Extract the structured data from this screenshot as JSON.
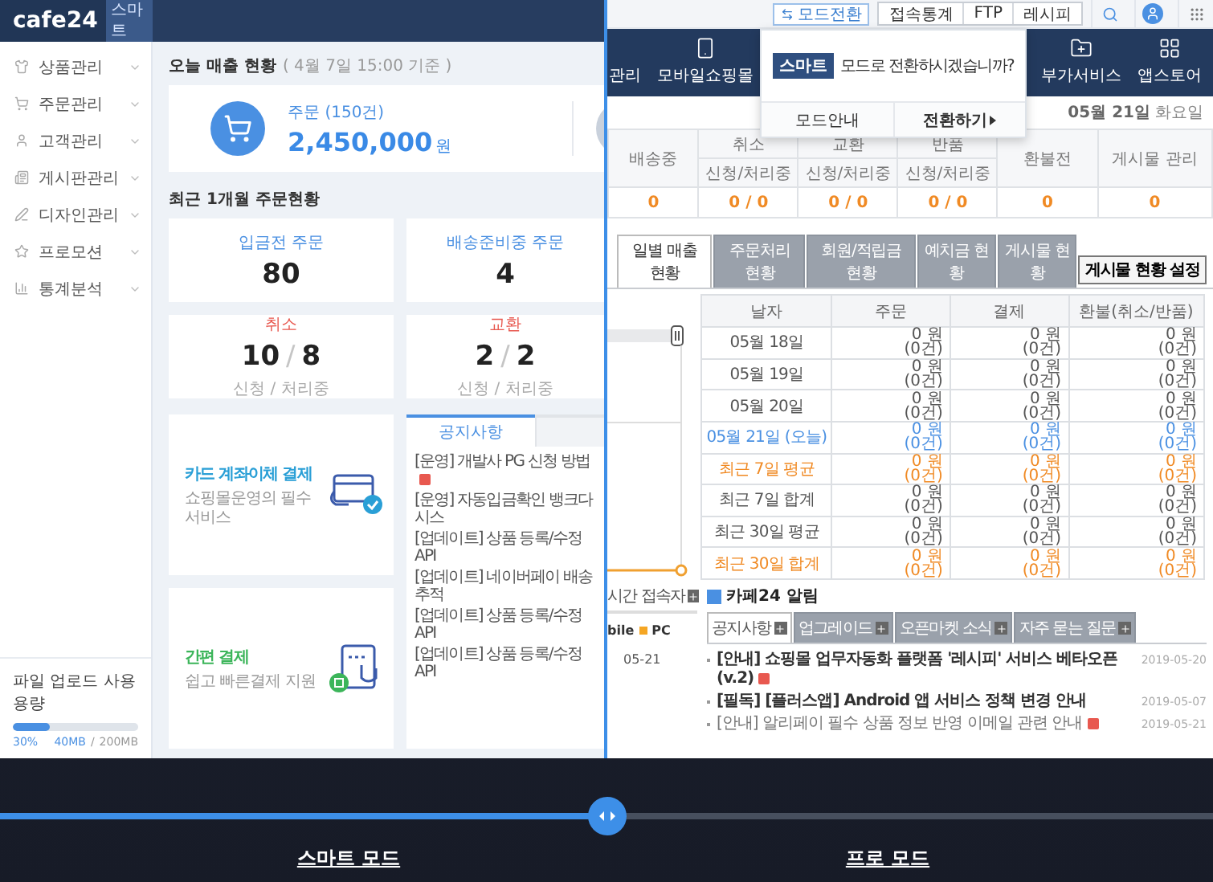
{
  "smart": {
    "logo": "cafe24",
    "badge": "스마트",
    "menu": [
      {
        "label": "상품관리",
        "kind": "product"
      },
      {
        "label": "주문관리",
        "kind": "order"
      },
      {
        "label": "고객관리",
        "kind": "customer"
      },
      {
        "label": "게시판관리",
        "kind": "board"
      },
      {
        "label": "디자인관리",
        "kind": "design"
      },
      {
        "label": "프로모션",
        "kind": "promotion"
      },
      {
        "label": "통계분석",
        "kind": "stats"
      }
    ],
    "usage": {
      "title": "파일 업로드 사용 용량",
      "level": 0.3,
      "percent": "30%",
      "used": "40MB",
      "sep": "/",
      "total": "200MB"
    },
    "sales": {
      "title": "오늘 매출 현황",
      "note": "( 4월 7일 15:00 기준 )",
      "label": "주문",
      "count": "(150건)",
      "amount": "2,450,000",
      "unit": "원"
    },
    "orders": {
      "title": "최근 1개월 주문현황",
      "cards": [
        {
          "label": "입금전 주문",
          "kind": "single",
          "value": "80"
        },
        {
          "label": "배송준비중 주문",
          "kind": "single",
          "value": "4"
        },
        {
          "label": "취소",
          "kind": "pair",
          "value": "10",
          "sep": "/",
          "value2": "8",
          "sub": "신청 / 처리중"
        },
        {
          "label": "교환",
          "kind": "pair",
          "value": "2",
          "sep": "/",
          "value2": "2",
          "sub": "신청 / 처리중"
        }
      ]
    },
    "services": [
      {
        "title": "카드 계좌이체 결제",
        "desc": "쇼핑몰운영의 필수 서비스",
        "kind": "card"
      },
      {
        "title": "간편 결제",
        "desc": "쉽고 빠른결제 지원",
        "kind": "simple"
      }
    ],
    "notice": {
      "tabs": [
        {
          "label": "공지사항",
          "selected": true
        }
      ],
      "items": [
        {
          "text": "[운영] 개발사 PG 신청 방법",
          "new": true
        },
        {
          "text": "[운영] 자동입금확인 뱅크다 시스",
          "new": false
        },
        {
          "text": "[업데이트] 상품 등록/수정 API",
          "new": false
        },
        {
          "text": "[업데이트] 네이버페이 배송추적",
          "new": false
        },
        {
          "text": "[업데이트] 상품 등록/수정 API",
          "new": false
        },
        {
          "text": "[업데이트] 상품 등록/수정 API",
          "new": false
        }
      ]
    }
  },
  "pro": {
    "mode_button": "모드전환",
    "top_buttons": [
      "접속통계",
      "FTP",
      "레시피"
    ],
    "nav_left": [
      {
        "label": "관리",
        "kind": "cut"
      },
      {
        "label": "모바일쇼핑몰",
        "kind": "mobile"
      }
    ],
    "nav_right": [
      {
        "label": "부가서비스",
        "kind": "addon"
      },
      {
        "label": "앱스토어",
        "kind": "apps"
      }
    ],
    "popup": {
      "badge": "스마트",
      "message": "모드로 전환하시겠습니까?",
      "buttons": [
        {
          "label": "모드안내",
          "kind": "plain"
        },
        {
          "label": "전환하기",
          "kind": "go"
        }
      ]
    },
    "date": "05월 21일",
    "weekday": "화요일",
    "summary": [
      {
        "head": "배송중",
        "value": "0"
      },
      {
        "head": "취소",
        "sub": "신청/처리중",
        "value": "0 / 0"
      },
      {
        "head": "교환",
        "sub": "신청/처리중",
        "value": "0 / 0"
      },
      {
        "head": "반품",
        "sub": "신청/처리중",
        "value": "0 / 0"
      },
      {
        "head": "환불전",
        "value": "0"
      },
      {
        "head": "게시물 관리",
        "value": "0"
      }
    ],
    "tabs": [
      {
        "label": "일별 매출 현황",
        "selected": true
      },
      {
        "label": "주문처리 현황",
        "selected": false
      },
      {
        "label": "회원/적립금 현황",
        "selected": false
      },
      {
        "label": "예치금 현황",
        "selected": false
      },
      {
        "label": "게시물 현황",
        "selected": false
      }
    ],
    "settings_button": "게시물 현황 설정",
    "chart_label": "05-21",
    "table": {
      "columns": [
        "날자",
        "주문",
        "결제",
        "환불(취소/반품)"
      ],
      "rows": [
        {
          "kind": "normal",
          "cells": [
            [
              "05월 18일"
            ],
            [
              "0 원",
              "(0건)"
            ],
            [
              "0 원",
              "(0건)"
            ],
            [
              "0 원",
              "(0건)"
            ]
          ]
        },
        {
          "kind": "normal",
          "cells": [
            [
              "05월 19일"
            ],
            [
              "0 원",
              "(0건)"
            ],
            [
              "0 원",
              "(0건)"
            ],
            [
              "0 원",
              "(0건)"
            ]
          ]
        },
        {
          "kind": "normal",
          "cells": [
            [
              "05월 20일"
            ],
            [
              "0 원",
              "(0건)"
            ],
            [
              "0 원",
              "(0건)"
            ],
            [
              "0 원",
              "(0건)"
            ]
          ]
        },
        {
          "kind": "today",
          "cells": [
            [
              "05월 21일 (오늘)"
            ],
            [
              "0 원",
              "(0건)"
            ],
            [
              "0 원",
              "(0건)"
            ],
            [
              "0 원",
              "(0건)"
            ]
          ]
        },
        {
          "kind": "average",
          "cells": [
            [
              "최근 7일 평균"
            ],
            [
              "0 원",
              "(0건)"
            ],
            [
              "0 원",
              "(0건)"
            ],
            [
              "0 원",
              "(0건)"
            ]
          ]
        },
        {
          "kind": "normal",
          "cells": [
            [
              "최근 7일 합계"
            ],
            [
              "0 원",
              "(0건)"
            ],
            [
              "0 원",
              "(0건)"
            ],
            [
              "0 원",
              "(0건)"
            ]
          ]
        },
        {
          "kind": "normal",
          "cells": [
            [
              "최근 30일 평균"
            ],
            [
              "0 원",
              "(0건)"
            ],
            [
              "0 원",
              "(0건)"
            ],
            [
              "0 원",
              "(0건)"
            ]
          ]
        },
        {
          "kind": "average",
          "cells": [
            [
              "최근 30일 합계"
            ],
            [
              "0 원",
              "(0건)"
            ],
            [
              "0 원",
              "(0건)"
            ],
            [
              "0 원",
              "(0건)"
            ]
          ]
        }
      ]
    },
    "visitors": {
      "tab": "시간 접속자",
      "cut_label": "bile",
      "legend": "PC"
    },
    "alerts": {
      "title": "카페24 알림",
      "tabs": [
        {
          "label": "공지사항",
          "selected": true
        },
        {
          "label": "업그레이드",
          "selected": false
        },
        {
          "label": "오픈마켓 소식",
          "selected": false
        },
        {
          "label": "자주 묻는 질문",
          "selected": false
        }
      ],
      "items": [
        {
          "text": "[안내] 쇼핑몰 업무자동화 플랫폼 '레시피' 서비스 베타오픈(v.2)",
          "new": true,
          "emphasis": true,
          "date": "2019-05-20"
        },
        {
          "text": "[필독] [플러스앱] Android 앱 서비스 정책 변경 안내",
          "new": false,
          "emphasis": true,
          "date": "2019-05-07"
        },
        {
          "text": "[안내] 알리페이 필수 상품 정보 반영 이메일 관련 안내",
          "new": true,
          "emphasis": false,
          "date": "2019-05-21"
        }
      ]
    }
  },
  "slider": {
    "level": 0.5,
    "labels": [
      "스마트 모드",
      "프로 모드"
    ]
  }
}
